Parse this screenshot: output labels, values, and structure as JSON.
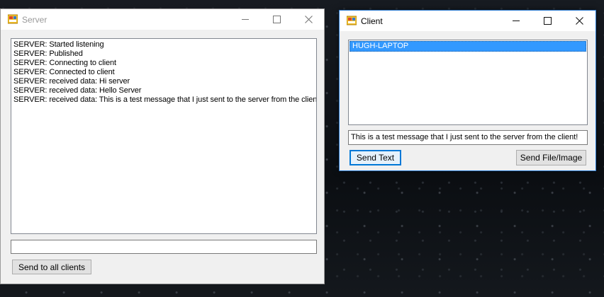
{
  "server_window": {
    "title": "Server",
    "log": [
      "SERVER: Started listening",
      "SERVER: Published",
      "SERVER: Connecting to client",
      "SERVER: Connected to client",
      "SERVER: received data: Hi server",
      "SERVER: received data: Hello Server",
      "SERVER: received data: This is a test message that I just sent to the server from the client"
    ],
    "message_input_value": "",
    "send_all_label": "Send to all clients"
  },
  "client_window": {
    "title": "Client",
    "servers": [
      "HUGH-LAPTOP"
    ],
    "message_input_value": "This is a test message that I just sent to the server from the client!",
    "send_text_label": "Send Text",
    "send_file_label": "Send File/Image"
  },
  "icons": {
    "app": "app-window-icon",
    "minimize": "minimize-icon",
    "maximize": "maximize-icon",
    "close": "close-icon"
  },
  "colors": {
    "selection": "#3399ff",
    "focus_border": "#0078d7",
    "active_window_border": "#2b7bd1"
  }
}
